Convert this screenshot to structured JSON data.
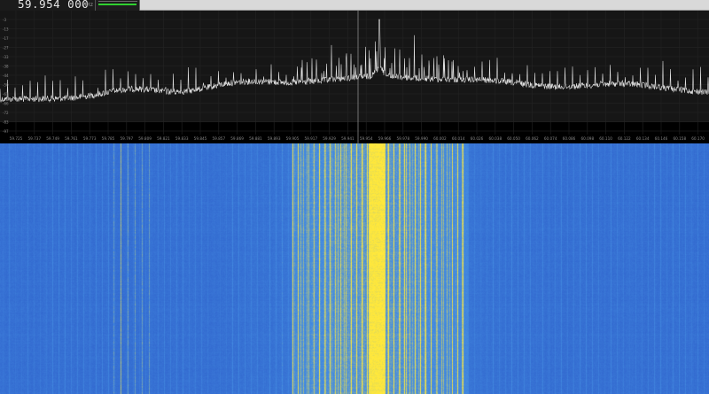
{
  "top_bar": {
    "frequency": "59.954 000",
    "frequency_unit": "MHz",
    "signal_level": 0.97
  },
  "spectrum": {
    "level_ticks": [
      "-3",
      "-13",
      "-17",
      "-27",
      "-33",
      "-38",
      "-44",
      "-50",
      "-61",
      "-66",
      "-72",
      "-83",
      "-97"
    ],
    "freq_labels": [
      "59.725",
      "59.737",
      "59.749",
      "59.761",
      "59.773",
      "59.785",
      "59.797",
      "59.809",
      "59.821",
      "59.833",
      "59.845",
      "59.857",
      "59.869",
      "59.881",
      "59.893",
      "59.905",
      "59.917",
      "59.929",
      "59.941",
      "59.954",
      "59.966",
      "59.978",
      "59.990",
      "60.002",
      "60.014",
      "60.026",
      "60.038",
      "60.050",
      "60.062",
      "60.074",
      "60.086",
      "60.098",
      "60.110",
      "60.122",
      "60.134",
      "60.146",
      "60.158",
      "60.170",
      "60.182"
    ]
  },
  "colors": {
    "spectrum_background": "#161616",
    "spectrum_trace": "#f2f2f2",
    "waterfall_base": "#3a6fd4",
    "waterfall_hot": "#ffe94a",
    "tuning_line": "#8a8a8a"
  }
}
